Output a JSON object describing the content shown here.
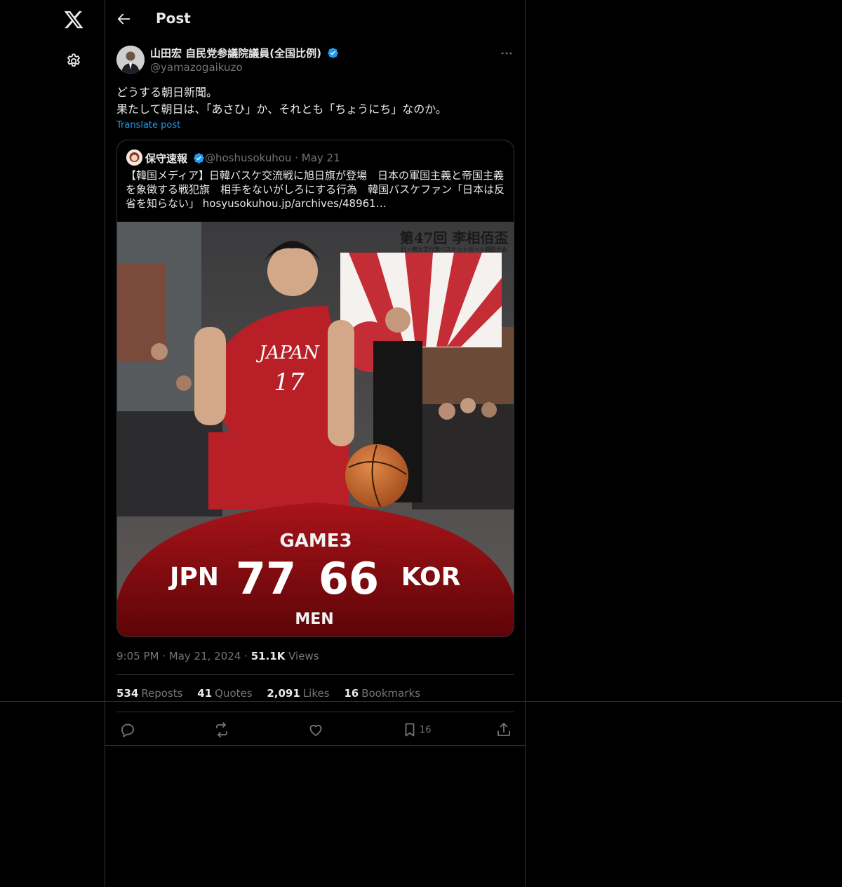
{
  "header": {
    "title": "Post"
  },
  "post": {
    "author_name": "山田宏 自民党参議院議員(全国比例)",
    "author_handle": "@yamazogaikuzo",
    "text_line1": "どうする朝日新聞。",
    "text_line2": "果たして朝日は、「あさひ」か、それとも「ちょうにち」なのか。",
    "translate_label": "Translate post",
    "time": "9:05 PM",
    "date": "May 21, 2024",
    "views_count": "51.1K",
    "views_label": "Views"
  },
  "quote": {
    "author_name": "保守速報",
    "author_handle": "@hoshusokuhou",
    "date": "May 21",
    "text": "【韓国メディア】日韓バスケ交流戦に旭日旗が登場　日本の軍国主義と帝国主義を象徴する戦犯旗　相手をないがしろにする行為　韓国バスケファン「日本は反省を知らない」 hosyusokuhou.jp/archives/48961…",
    "image": {
      "banner_text": "第47回 李相佰盃",
      "banner_subtext": "日・韓大学代表バスケットボール競技大会",
      "jersey_text": "JAPAN",
      "jersey_number": "17",
      "game_label": "GAME3",
      "team_left": "JPN",
      "score_left": "77",
      "score_right": "66",
      "team_right": "KOR",
      "division": "MEN"
    }
  },
  "stats": {
    "reposts_count": "534",
    "reposts_label": "Reposts",
    "quotes_count": "41",
    "quotes_label": "Quotes",
    "likes_count": "2,091",
    "likes_label": "Likes",
    "bookmarks_count": "16",
    "bookmarks_label": "Bookmarks"
  },
  "actions": {
    "bookmark_count": "16"
  },
  "colors": {
    "background": "#000000",
    "border": "#2f3336",
    "accent": "#1d9bf0",
    "muted": "#71767b",
    "text": "#e7e9ea"
  }
}
